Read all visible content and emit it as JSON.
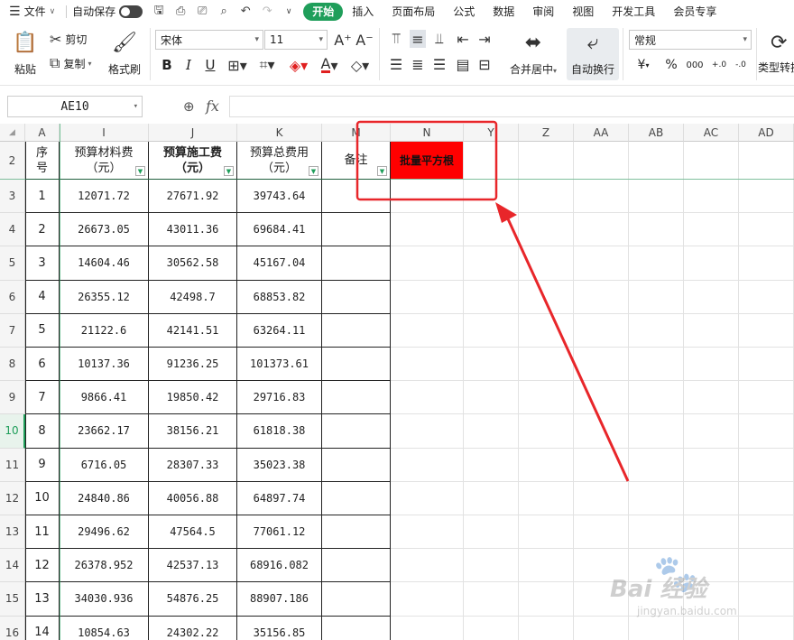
{
  "titlebar": {
    "file_label": "文件",
    "autosave_label": "自动保存",
    "tabs": [
      {
        "label": "开始",
        "active": true
      },
      {
        "label": "插入"
      },
      {
        "label": "页面布局"
      },
      {
        "label": "公式"
      },
      {
        "label": "数据"
      },
      {
        "label": "审阅"
      },
      {
        "label": "视图"
      },
      {
        "label": "开发工具"
      },
      {
        "label": "会员专享"
      }
    ]
  },
  "ribbon": {
    "paste_label": "粘贴",
    "cut_label": "剪切",
    "copy_label": "复制",
    "format_painter_label": "格式刷",
    "font_name": "宋体",
    "font_size": "11",
    "merge_center_label": "合并居中",
    "wrap_text_label": "自动换行",
    "number_format": "常规",
    "type_convert_label": "类型转换",
    "currency_symbol": "¥",
    "percent_symbol": "%",
    "thousands_label": "000",
    "inc_decimal_label": "+.0",
    "dec_decimal_label": "-.0"
  },
  "formula": {
    "name_box": "AE10",
    "fx_label": "fx",
    "value": ""
  },
  "sheet": {
    "columns": [
      "A",
      "I",
      "J",
      "K",
      "M",
      "N",
      "Y",
      "Z",
      "AA",
      "AB",
      "AC",
      "AD"
    ],
    "header_row": {
      "row_label": "2",
      "seq": "序号",
      "material": "预算材料费（元）",
      "labor": "预算施工费（元）",
      "total": "预算总费用（元）",
      "note": "备注",
      "batch_sqrt": "批量平方根"
    },
    "rows": [
      {
        "r": "3",
        "seq": "1",
        "material": "12071.72",
        "labor": "27671.92",
        "total": "39743.64"
      },
      {
        "r": "4",
        "seq": "2",
        "material": "26673.05",
        "labor": "43011.36",
        "total": "69684.41"
      },
      {
        "r": "5",
        "seq": "3",
        "material": "14604.46",
        "labor": "30562.58",
        "total": "45167.04"
      },
      {
        "r": "6",
        "seq": "4",
        "material": "26355.12",
        "labor": "42498.7",
        "total": "68853.82"
      },
      {
        "r": "7",
        "seq": "5",
        "material": "21122.6",
        "labor": "42141.51",
        "total": "63264.11"
      },
      {
        "r": "8",
        "seq": "6",
        "material": "10137.36",
        "labor": "91236.25",
        "total": "101373.61"
      },
      {
        "r": "9",
        "seq": "7",
        "material": "9866.41",
        "labor": "19850.42",
        "total": "29716.83"
      },
      {
        "r": "10",
        "seq": "8",
        "material": "23662.17",
        "labor": "38156.21",
        "total": "61818.38"
      },
      {
        "r": "11",
        "seq": "9",
        "material": "6716.05",
        "labor": "28307.33",
        "total": "35023.38"
      },
      {
        "r": "12",
        "seq": "10",
        "material": "24840.86",
        "labor": "40056.88",
        "total": "64897.74"
      },
      {
        "r": "13",
        "seq": "11",
        "material": "29496.62",
        "labor": "47564.5",
        "total": "77061.12"
      },
      {
        "r": "14",
        "seq": "12",
        "material": "26378.952",
        "labor": "42537.13",
        "total": "68916.082"
      },
      {
        "r": "15",
        "seq": "13",
        "material": "34030.936",
        "labor": "54876.25",
        "total": "88907.186"
      },
      {
        "r": "16",
        "seq": "14",
        "material": "10854.63",
        "labor": "24302.22",
        "total": "35156.85"
      }
    ],
    "selected_row": "10"
  },
  "colors": {
    "accent": "#1f9e5a",
    "highlight_red": "#ff0000",
    "annotation_red": "#e8262a"
  },
  "watermark": {
    "text": "Bai 经验",
    "sub": "jingyan.baidu.com"
  }
}
